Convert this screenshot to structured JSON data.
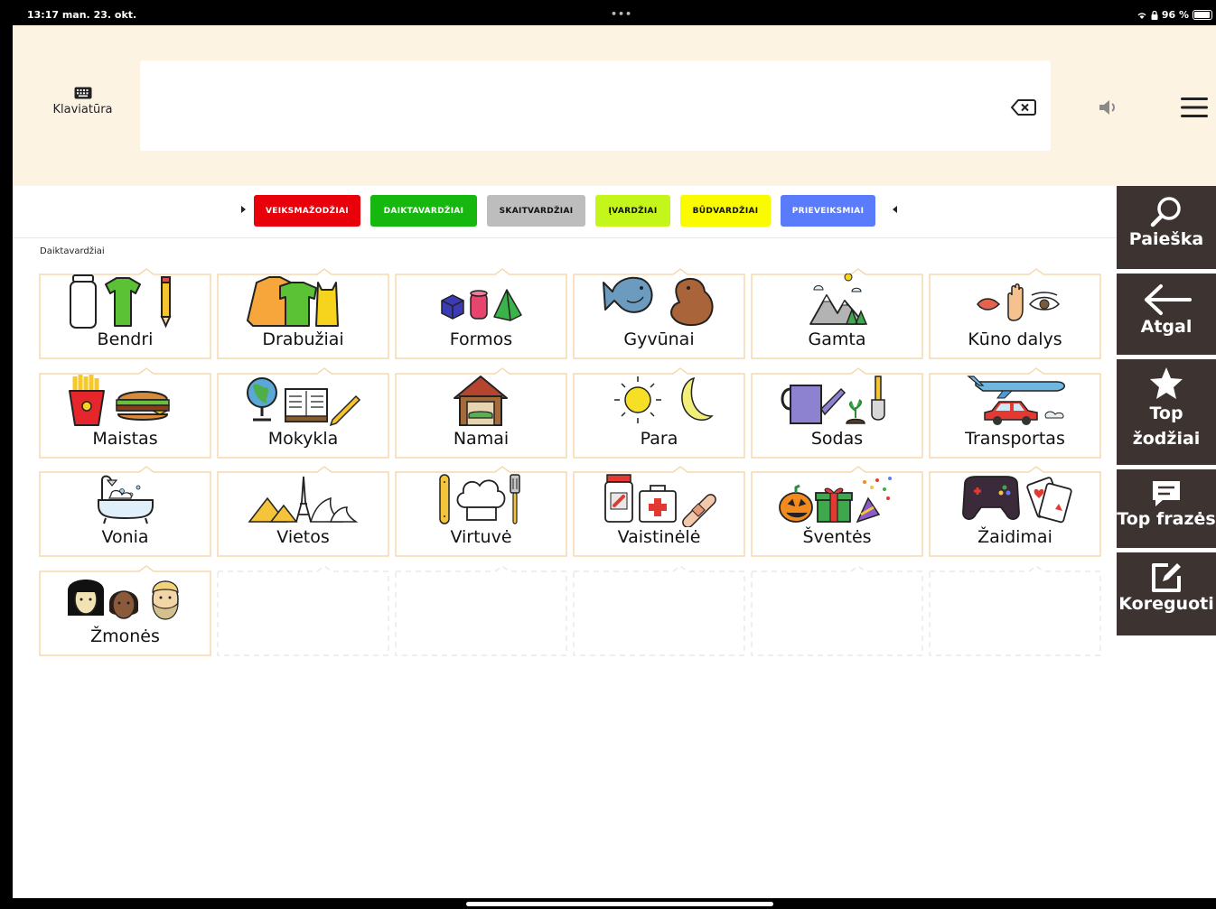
{
  "status_bar": {
    "time_date": "13:17  man. 23. okt.",
    "dots": "•••",
    "battery": "96 %"
  },
  "top": {
    "keyboard_label": "Klaviatūra"
  },
  "tabs": [
    {
      "label": "VEIKSMAŽODŽIAI",
      "color": "#e8000b",
      "text": "#ffffff"
    },
    {
      "label": "DAIKTAVARDŽIAI",
      "color": "#16b80f",
      "text": "#ffffff"
    },
    {
      "label": "SKAITVARDŽIAI",
      "color": "#bdbdbd",
      "text": "#111111"
    },
    {
      "label": "ĮVARDŽIAI",
      "color": "#c4f61b",
      "text": "#111111"
    },
    {
      "label": "BŪDVARDŽIAI",
      "color": "#fbfb00",
      "text": "#111111"
    },
    {
      "label": "PRIEVEIKSMIAI",
      "color": "#5b7cfa",
      "text": "#ffffff"
    }
  ],
  "section_title": "Daiktavardžiai",
  "tiles": [
    {
      "label": "Bendri",
      "icon": "jar-shirt-pencil-icon"
    },
    {
      "label": "Drabužiai",
      "icon": "clothes-icon"
    },
    {
      "label": "Formos",
      "icon": "shapes-icon"
    },
    {
      "label": "Gyvūnai",
      "icon": "animals-icon"
    },
    {
      "label": "Gamta",
      "icon": "nature-icon"
    },
    {
      "label": "Kūno dalys",
      "icon": "body-parts-icon"
    },
    {
      "label": "Maistas",
      "icon": "food-icon"
    },
    {
      "label": "Mokykla",
      "icon": "school-icon"
    },
    {
      "label": "Namai",
      "icon": "house-icon"
    },
    {
      "label": "Para",
      "icon": "sun-moon-icon"
    },
    {
      "label": "Sodas",
      "icon": "garden-icon"
    },
    {
      "label": "Transportas",
      "icon": "transport-icon"
    },
    {
      "label": "Vonia",
      "icon": "bathtub-icon"
    },
    {
      "label": "Vietos",
      "icon": "places-icon"
    },
    {
      "label": "Virtuvė",
      "icon": "kitchen-icon"
    },
    {
      "label": "Vaistinėlė",
      "icon": "pharmacy-icon"
    },
    {
      "label": "Šventės",
      "icon": "holidays-icon"
    },
    {
      "label": "Žaidimai",
      "icon": "games-icon"
    },
    {
      "label": "Žmonės",
      "icon": "people-icon"
    }
  ],
  "sidebar": {
    "search": "Paieška",
    "back": "Atgal",
    "top_words_1": "Top",
    "top_words_2": "žodžiai",
    "top_phrases": "Top frazės",
    "edit": "Koreguoti"
  }
}
